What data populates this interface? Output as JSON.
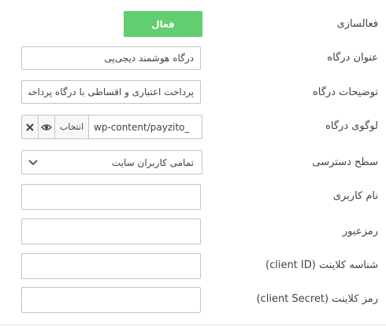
{
  "activation": {
    "label": "فعالسازی",
    "toggle_text": "فعال",
    "toggle_color": "#61ce70"
  },
  "gateway_title": {
    "label": "عنوان درگاه",
    "value": "درگاه هوشمند دیجی‌پی"
  },
  "gateway_description": {
    "label": "توضیحات درگاه",
    "value": "پرداخت اعتباری و اقساطی با درگاه پرداخت"
  },
  "gateway_logo": {
    "label": "لوگوی درگاه",
    "choose_label": "انتخاب",
    "path": "wp-content/payzito_",
    "preview_icon": "eye-icon",
    "remove_icon": "close-icon"
  },
  "access_level": {
    "label": "سطح دسترسی",
    "selected": "تمامی کاربران سایت",
    "icon": "chevron-down-icon"
  },
  "username": {
    "label": "نام کاربری",
    "value": ""
  },
  "password": {
    "label": "رمزعبور",
    "value": ""
  },
  "client_id": {
    "label": "شناسه کلاینت (client ID)",
    "value": ""
  },
  "client_secret": {
    "label": "رمز کلاینت (client Secret)",
    "value": ""
  }
}
